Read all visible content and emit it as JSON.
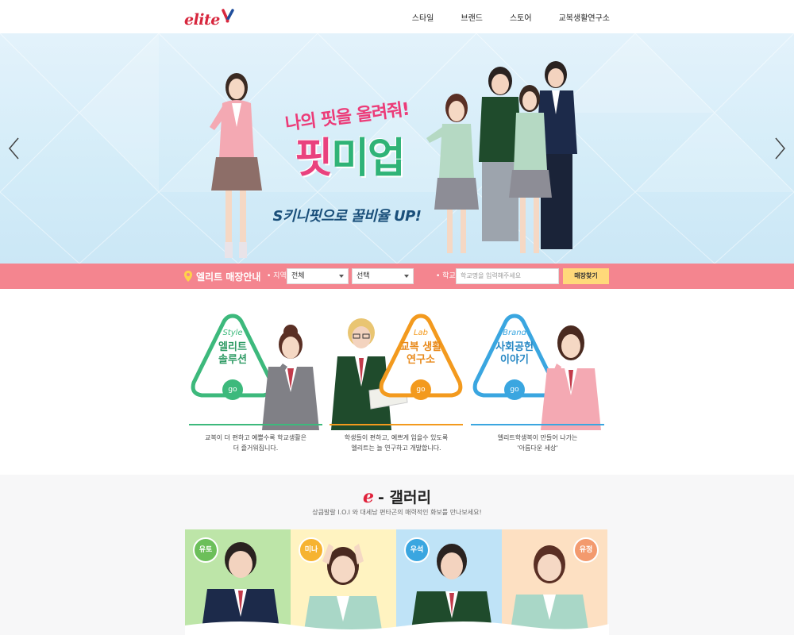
{
  "header": {
    "logo": "elite",
    "nav": [
      "스타일",
      "브랜드",
      "스토어",
      "교복생활연구소"
    ]
  },
  "hero": {
    "line1": "나의 핏을 올려줘!",
    "line2_pink": "핏",
    "line2_green": "미업",
    "line3": "S키니핏으로 꿀비율 UP!"
  },
  "store": {
    "title": "엘리트 매장안내",
    "region_label": "• 지역",
    "region_value": "전체",
    "sub_value": "선택",
    "school_label": "• 학교",
    "school_placeholder": "학교명을 입력해주세요",
    "button": "매장찾기"
  },
  "features": [
    {
      "sub": "Style",
      "title1": "엘리트",
      "title2": "솔루션",
      "go": "go",
      "desc1": "교복이 더 편하고 예쁠수록 학교생활은",
      "desc2": "더 즐거워집니다."
    },
    {
      "sub": "Lab",
      "title1": "교복 생활",
      "title2": "연구소",
      "go": "go",
      "desc1": "학생들이 편하고, 예쁘게 입을수 있도록",
      "desc2": "엘리트는 늘 연구하고 개발합니다."
    },
    {
      "sub": "Brand",
      "title1": "사회공헌",
      "title2": "이야기",
      "go": "go",
      "desc1": "엘리트학생복이 만들어 나가는",
      "desc2": "'아름다운 세상'"
    }
  ],
  "gallery": {
    "e": "e",
    "title": "- 갤러리",
    "subtitle": "상큼발랄 I.O.I 와 대세남 편타곤의 매력적인 화보를 만나보세요!",
    "cards": [
      "유토",
      "미나",
      "우석",
      "유정"
    ]
  },
  "colors": {
    "brand_red": "#d7263d",
    "store_bar": "#f4858f",
    "style_green": "#3db97c",
    "lab_orange": "#f39a1e",
    "brand_blue": "#3aa6e0"
  }
}
